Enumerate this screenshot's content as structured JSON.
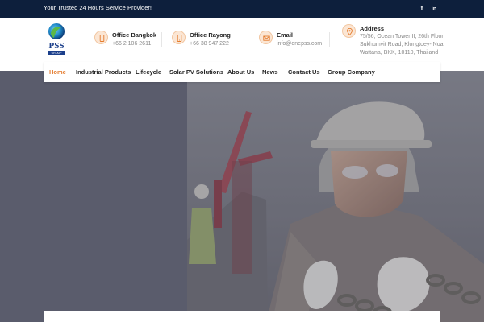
{
  "topbar": {
    "tagline": "Your Trusted 24 Hours Service Provider!",
    "social": [
      {
        "icon": "facebook-icon",
        "glyph": "f"
      },
      {
        "icon": "linkedin-icon",
        "glyph": "in"
      }
    ]
  },
  "brand": {
    "logo_text": "PSS",
    "logo_subtext": "GROUP",
    "accent": "#e47b2d",
    "dark": "#0d1f3c"
  },
  "contacts": [
    {
      "icon": "phone-icon",
      "title": "Office Bangkok",
      "value": "+66 2 106 2611"
    },
    {
      "icon": "phone-icon",
      "title": "Office Rayong",
      "value": "+66 38 947 222"
    },
    {
      "icon": "envelope-icon",
      "title": "Email",
      "value": "info@onepss.com"
    },
    {
      "icon": "location-pin-icon",
      "title": "Address",
      "lines": [
        "75/56, Ocean Tower II, 26th Floor",
        "Sukhumvit Road, Klongtoey- Noa",
        "Wattana, BKK, 10110, Thailand"
      ]
    }
  ],
  "nav": {
    "active": "Home",
    "items": [
      "Home",
      "Industrial Products",
      "Lifecycle",
      "Solar PV Solutions",
      "About Us",
      "News",
      "Contact Us",
      "Group Company"
    ]
  }
}
